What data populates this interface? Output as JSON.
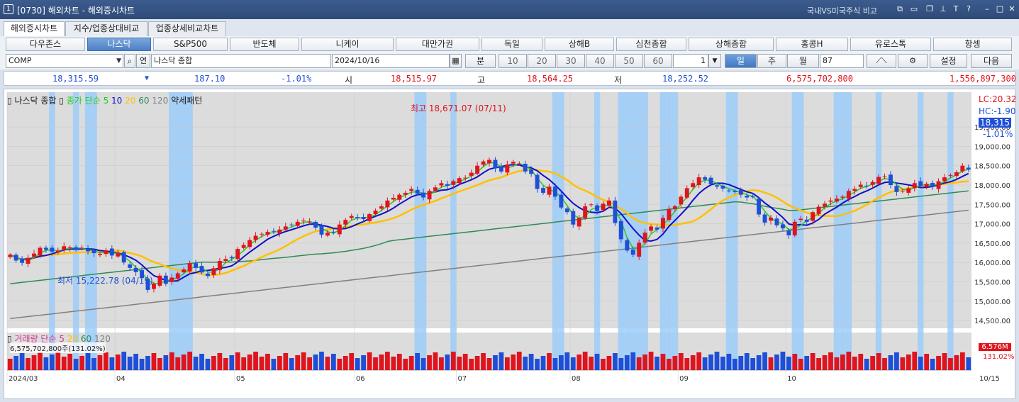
{
  "window": {
    "num": "1",
    "title": "[0730] 해외차트 - 해외증시차트",
    "compare": "국내VS미국주식 비교"
  },
  "tabs": [
    "해외증시차트",
    "지수/업종상대비교",
    "업종상세비교차트"
  ],
  "markets": [
    "다우존스",
    "나스닥",
    "S&P500",
    "반도체",
    "니케이",
    "대만가권",
    "독일",
    "상해B",
    "심천종합",
    "상해종합",
    "홍콩H",
    "유로스톡",
    "항셍"
  ],
  "controls": {
    "symbol": "COMP",
    "name": "나스닥 종합",
    "date": "2024/10/16",
    "query_btn": "조",
    "kr_btn": "연",
    "periods": [
      "분",
      "10",
      "20",
      "30",
      "40",
      "50",
      "60"
    ],
    "count": "1",
    "day": "일",
    "week": "주",
    "month": "월",
    "bars": "87",
    "settings": "설정",
    "next": "다음"
  },
  "quote": {
    "last": "18,315.59",
    "change_sign": "▼",
    "change": "187.10",
    "pct": "-1.01%",
    "open_lbl": "시",
    "open": "18,515.97",
    "high_lbl": "고",
    "high": "18,564.25",
    "low_lbl": "저",
    "low": "18,252.52",
    "volume": "6,575,702,800",
    "amount": "1,556,897,300"
  },
  "legend": {
    "name": "나스닥 종합",
    "close": "종가",
    "simple": "단순",
    "ma5": "5",
    "ma10": "10",
    "ma20": "20",
    "ma60": "60",
    "ma120": "120",
    "pattern": "약세패턴"
  },
  "annotations": {
    "high": "최고 18,671.07 (07/11)",
    "low": "최저 15,222.78 (04/19)",
    "lc": "LC:20.32",
    "hc": "HC:-1.90",
    "last_box": "18,315",
    "pct_box": "-1.01%"
  },
  "vol_legend": {
    "name": "거래량",
    "simple": "단순",
    "ma5": "5",
    "ma20": "20",
    "ma60": "60",
    "ma120": "120",
    "value": "6,575,702,800주(131.02%)",
    "box": "6.576M",
    "pct": "131.02%"
  },
  "chart_data": {
    "type": "candlestick",
    "ylim": [
      14300,
      20400
    ],
    "y_ticks": [
      "19,500.00",
      "19,000.00",
      "18,500.00",
      "18,000.00",
      "17,500.00",
      "17,000.00",
      "16,500.00",
      "16,000.00",
      "15,500.00",
      "15,000.00",
      "14,500.00"
    ],
    "x_labels": [
      "2024/03",
      "04",
      "05",
      "06",
      "07",
      "08",
      "09",
      "10",
      "10/15"
    ],
    "colors": {
      "up": "#e0141e",
      "down": "#1f4fd8",
      "ma5": "#22cc22",
      "ma10": "#1010c8",
      "ma20": "#ffc000",
      "ma60": "#2e8b57",
      "ma120": "#808080",
      "highlight": "#9ccdfa"
    },
    "close": [
      16200,
      16050,
      15990,
      16120,
      16230,
      16380,
      16330,
      16280,
      16300,
      16420,
      16390,
      16330,
      16380,
      16290,
      16240,
      16220,
      16310,
      16180,
      16240,
      16000,
      15860,
      15750,
      15600,
      15290,
      15450,
      15660,
      15450,
      15610,
      15720,
      15820,
      15980,
      15860,
      15740,
      15650,
      15850,
      16040,
      16090,
      16110,
      16350,
      16450,
      16580,
      16690,
      16740,
      16790,
      16800,
      16850,
      16930,
      16970,
      17050,
      17080,
      17050,
      16900,
      16720,
      16770,
      16780,
      16980,
      17100,
      17200,
      17150,
      17120,
      17250,
      17340,
      17450,
      17600,
      17670,
      17750,
      17800,
      17900,
      17780,
      17680,
      17850,
      17940,
      18050,
      17980,
      18100,
      18180,
      18190,
      18320,
      18500,
      18610,
      18650,
      18430,
      18350,
      18530,
      18600,
      18550,
      18350,
      18290,
      17900,
      17800,
      17960,
      17700,
      17420,
      17300,
      16980,
      17150,
      17450,
      17500,
      17330,
      17520,
      17600,
      17020,
      16600,
      16310,
      16200,
      16510,
      16770,
      16930,
      16850,
      17150,
      17380,
      17450,
      17700,
      17920,
      18050,
      18200,
      18140,
      18020,
      17960,
      17910,
      17850,
      17820,
      17750,
      17680,
      17700,
      17240,
      17030,
      17160,
      16960,
      16880,
      16700,
      17050,
      17130,
      17050,
      17300,
      17440,
      17520,
      17600,
      17650,
      17700,
      17850,
      17900,
      18010,
      17980,
      18080,
      18210,
      18220,
      18000,
      17820,
      17850,
      17920,
      18050,
      17980,
      18030,
      17950,
      18100,
      18200,
      18260,
      18330,
      18500,
      18400
    ]
  }
}
